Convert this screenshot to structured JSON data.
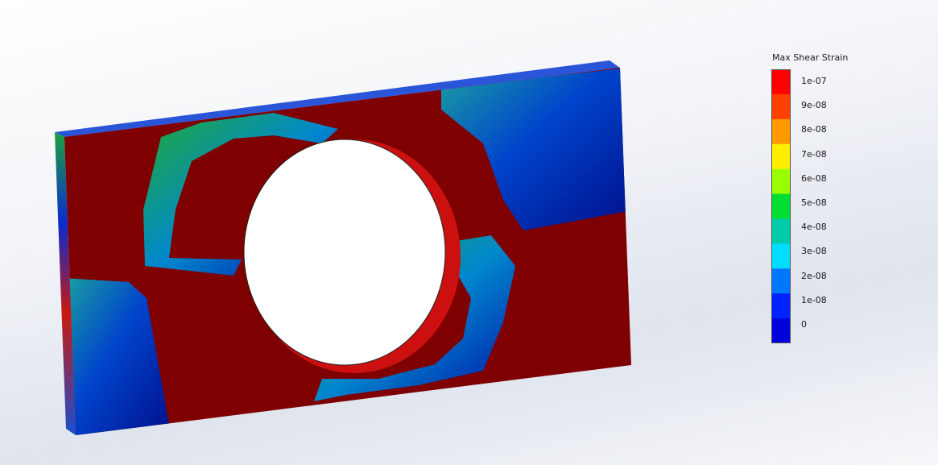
{
  "view": {
    "background_top": "#ffffff",
    "background_bottom": "#dfe4ed"
  },
  "model": {
    "part": "plate-with-hole",
    "colors": {
      "max": "#7f0000",
      "high": "#ff0000",
      "mid_high": "#ff9900",
      "mid": "#33cc00",
      "mid_low": "#00c0c0",
      "low": "#0066ff",
      "min": "#0000cc"
    }
  },
  "legend": {
    "title": "Max Shear Strain",
    "labels": [
      "1e-07",
      "9e-08",
      "8e-08",
      "7e-08",
      "6e-08",
      "5e-08",
      "4e-08",
      "3e-08",
      "2e-08",
      "1e-08",
      "0"
    ],
    "colors": [
      "#ff0000",
      "#ff4000",
      "#ff9900",
      "#ffee00",
      "#99ff00",
      "#00dd33",
      "#00ccaa",
      "#00ddff",
      "#0077ff",
      "#0022ff",
      "#0000dd"
    ]
  }
}
